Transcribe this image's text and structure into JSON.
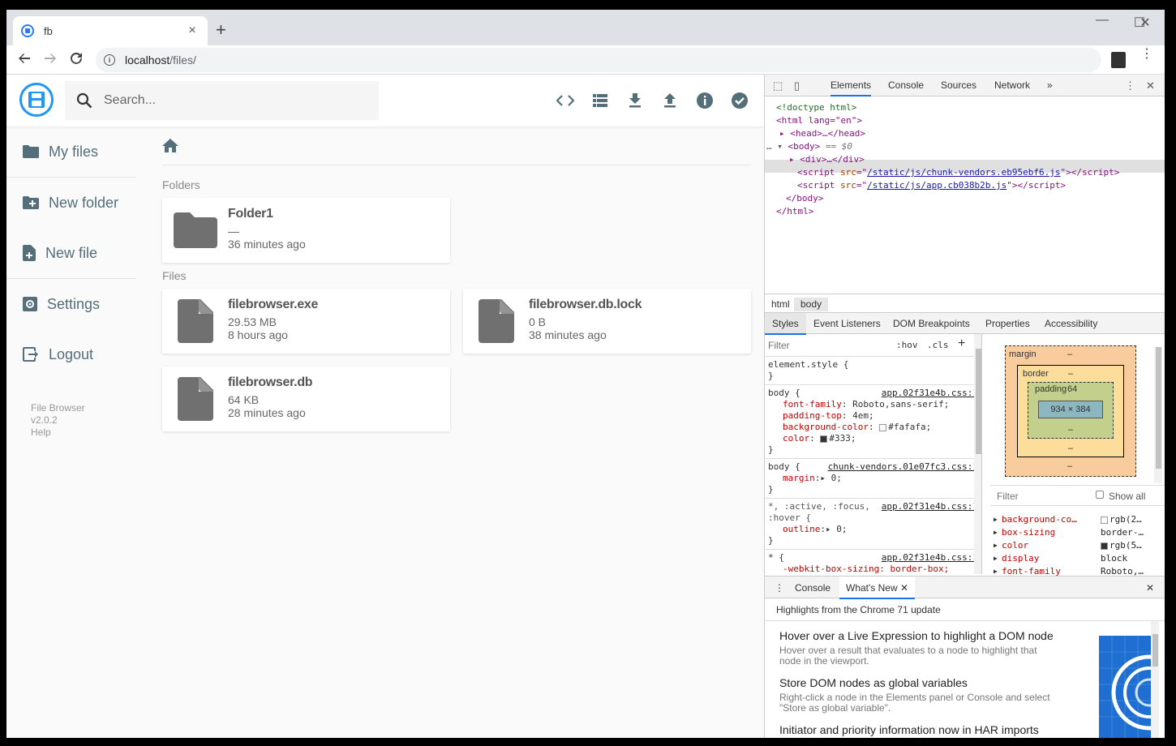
{
  "browser": {
    "tab_title": "fb",
    "url_host": "localhost",
    "url_path": "/files/",
    "new_tab": "+",
    "close_tab": "×",
    "minimize": "—",
    "maximize": "☐",
    "close_window": "✕"
  },
  "app": {
    "search_placeholder": "Search...",
    "header_actions": [
      "code-icon",
      "list-view-icon",
      "download-icon",
      "upload-icon",
      "info-icon",
      "check-circle-icon"
    ],
    "sidebar": {
      "items": [
        {
          "label": "My files",
          "icon": "folder-icon"
        },
        {
          "label": "New folder",
          "icon": "create-new-folder-icon"
        },
        {
          "label": "New file",
          "icon": "note-add-icon"
        },
        {
          "label": "Settings",
          "icon": "settings-icon"
        },
        {
          "label": "Logout",
          "icon": "exit-icon"
        }
      ],
      "footer": {
        "name": "File Browser",
        "version": "v2.0.2",
        "help": "Help"
      }
    },
    "folders_label": "Folders",
    "files_label": "Files",
    "folders": [
      {
        "name": "Folder1",
        "size": "—",
        "modified": "36 minutes ago"
      }
    ],
    "files": [
      {
        "name": "filebrowser.exe",
        "size": "29.53 MB",
        "modified": "8 hours ago"
      },
      {
        "name": "filebrowser.db.lock",
        "size": "0 B",
        "modified": "38 minutes ago"
      },
      {
        "name": "filebrowser.db",
        "size": "64 KB",
        "modified": "28 minutes ago"
      }
    ],
    "icon_color": "#707070",
    "accent_color": "#2196f3"
  },
  "devtools": {
    "tabs": [
      "Elements",
      "Console",
      "Sources",
      "Network"
    ],
    "more_tabs": "»",
    "elements": {
      "doctype": "<!doctype html>",
      "html_open": "<html lang=\"en\">",
      "head": "<head>…</head>",
      "body_tag": "<body>",
      "body_eq": " == $0",
      "div": "<div>…</div>",
      "script1_src": "/static/js/chunk-vendors.eb95ebf6.js",
      "script2_src": "/static/js/app.cb038b2b.js",
      "body_close": "</body>",
      "html_close": "</html>"
    },
    "breadcrumbs": [
      "html",
      "body"
    ],
    "sub_tabs": [
      "Styles",
      "Event Listeners",
      "DOM Breakpoints",
      "Properties",
      "Accessibility"
    ],
    "filter_placeholder": "Filter",
    "hov": ":hov",
    "cls": ".cls",
    "rules": {
      "element_style": "element.style {",
      "body1_src": "app.02f31e4b.css:1",
      "body1_props": [
        {
          "k": "font-family",
          "v": "Roboto,sans-serif;"
        },
        {
          "k": "padding-top",
          "v": "4em;"
        },
        {
          "k": "background-color",
          "v": "#fafafa;"
        },
        {
          "k": "color",
          "v": "#333;"
        }
      ],
      "body2_src": "chunk-vendors.01e07fc3.css:1",
      "body2_prop": {
        "k": "margin",
        "v": "0;"
      },
      "universal_selector": "*, :active, :focus,",
      "universal_hover": ":hover {",
      "universal_src": "app.02f31e4b.css:1",
      "outline_prop": {
        "k": "outline",
        "v": "0;"
      },
      "star_selector": "* {",
      "star_src": "app.02f31e4b.css:1",
      "star_prop": "-webkit-box-sizing: border-box;"
    },
    "box_model": {
      "margin_label": "margin",
      "border_label": "border",
      "padding_label": "padding",
      "padding_top": "64",
      "content": "934 × 384",
      "dash": "–"
    },
    "computed_filter": "Filter",
    "show_all": "Show all",
    "computed": [
      {
        "k": "background-co…",
        "v": "rgb(2…",
        "swatch": "#fafafa"
      },
      {
        "k": "box-sizing",
        "v": "border-…"
      },
      {
        "k": "color",
        "v": "rgb(5…",
        "swatch": "#333333"
      },
      {
        "k": "display",
        "v": "block"
      },
      {
        "k": "font-family",
        "v": "Roboto,…"
      }
    ],
    "drawer_tabs": [
      "Console",
      "What's New"
    ],
    "whats_new": {
      "heading": "Highlights from the Chrome 71 update",
      "items": [
        {
          "title": "Hover over a Live Expression to highlight a DOM node",
          "desc": "Hover over a result that evaluates to a node to highlight that node in the viewport."
        },
        {
          "title": "Store DOM nodes as global variables",
          "desc": "Right-click a node in the Elements panel or Console and select \"Store as global variable\"."
        },
        {
          "title": "Initiator and priority information now in HAR imports",
          "desc": ""
        }
      ]
    }
  }
}
